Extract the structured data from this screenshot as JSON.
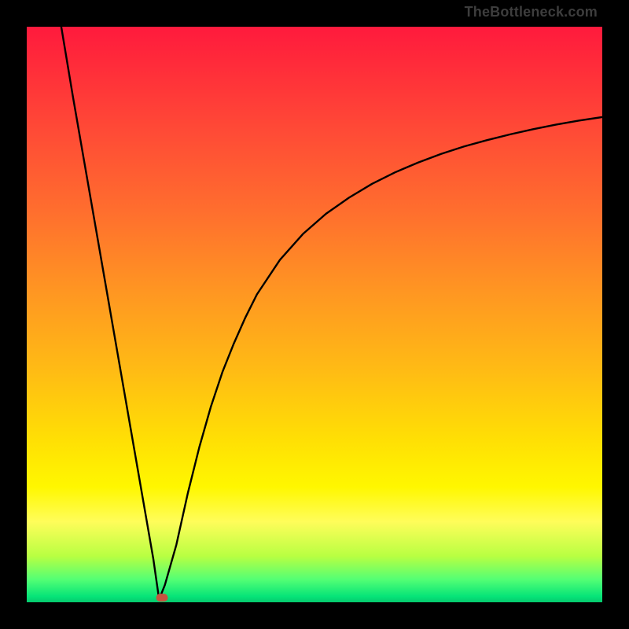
{
  "attribution": "TheBottleneck.com",
  "chart_data": {
    "type": "line",
    "title": "",
    "xlabel": "",
    "ylabel": "",
    "xlim": [
      0,
      100
    ],
    "ylim": [
      0,
      100
    ],
    "grid": false,
    "legend": "none",
    "description": "V-shaped bottleneck curve over red-to-green gradient background. Left branch descends nearly linearly from top-left to the minimum near x≈23 (y≈0), right branch rises with diminishing slope toward ~y≈85 at the right edge.",
    "series": [
      {
        "name": "bottleneck-curve",
        "x": [
          6,
          8,
          10,
          12,
          14,
          16,
          18,
          20,
          22,
          23,
          24,
          26,
          28,
          30,
          32,
          34,
          36,
          38,
          40,
          44,
          48,
          52,
          56,
          60,
          64,
          68,
          72,
          76,
          80,
          84,
          88,
          92,
          96,
          100
        ],
        "y": [
          100,
          88,
          76.5,
          65,
          53.5,
          42,
          30.5,
          19,
          7.5,
          0.5,
          3,
          10,
          19,
          27,
          34,
          40,
          45,
          49.5,
          53.5,
          59.5,
          64,
          67.5,
          70.3,
          72.7,
          74.7,
          76.4,
          77.9,
          79.2,
          80.3,
          81.3,
          82.2,
          83,
          83.7,
          84.3
        ]
      }
    ],
    "marker": {
      "x": 23.5,
      "y": 0.8,
      "shape": "rounded-rect",
      "color": "#c65540"
    },
    "background_gradient": {
      "top": "#ff1a3d",
      "middle": "#ffe004",
      "bottom": "#06c96e"
    }
  }
}
